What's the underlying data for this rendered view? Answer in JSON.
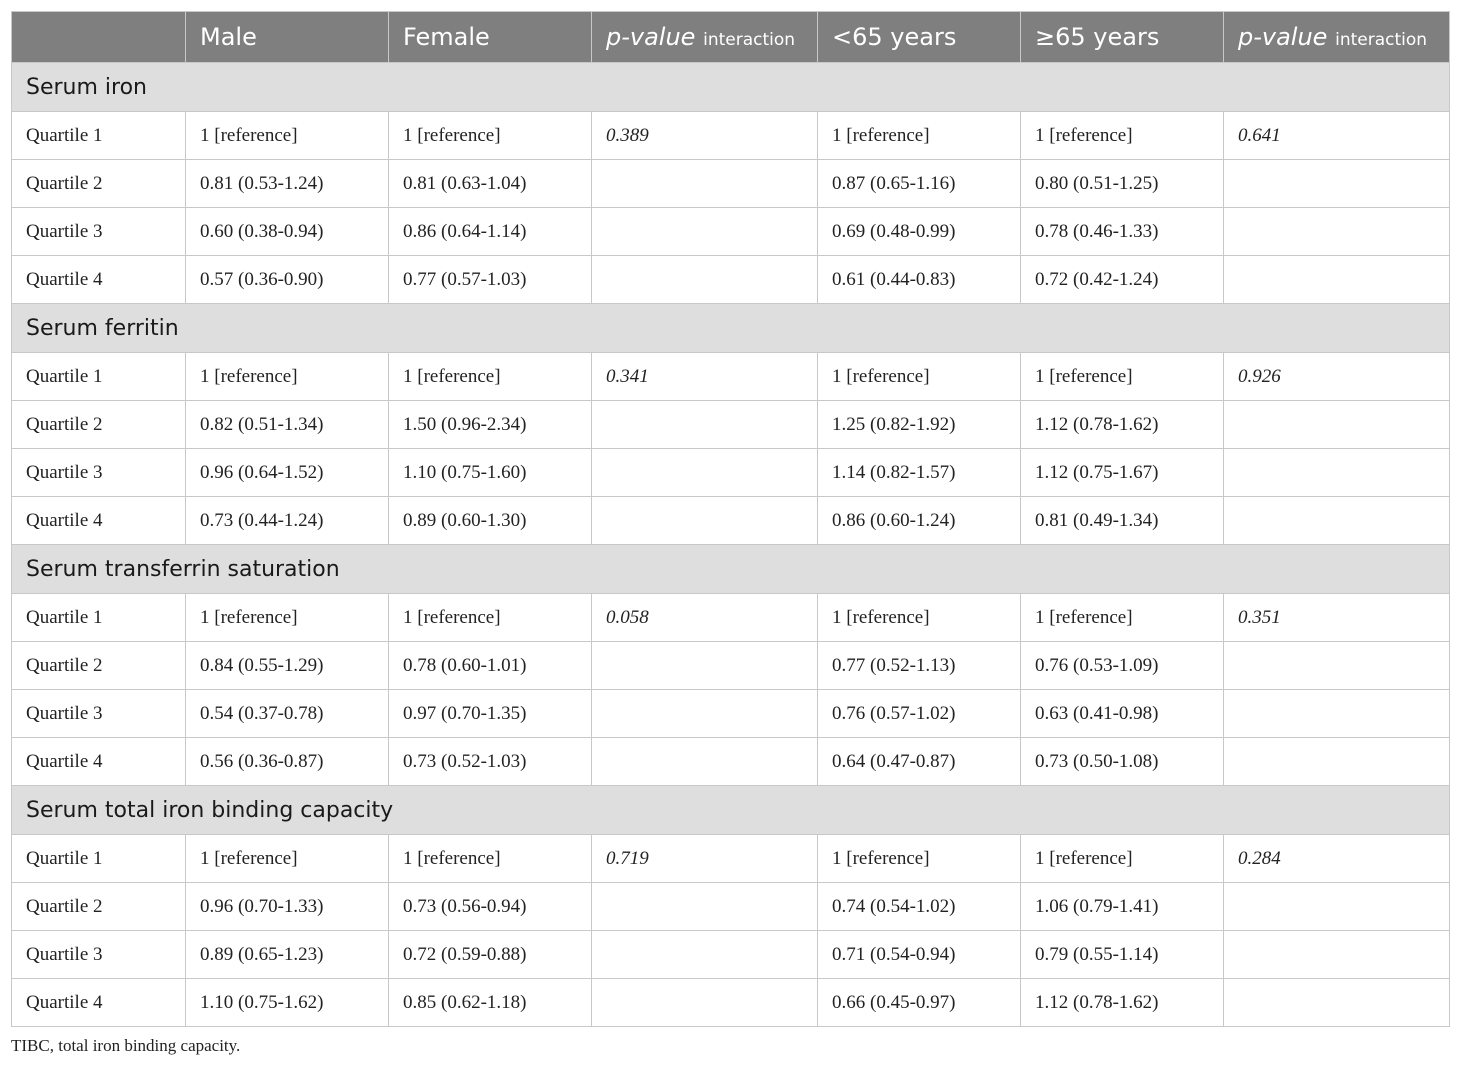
{
  "header": {
    "col0": "",
    "male": "Male",
    "female": "Female",
    "p_label": "p-value",
    "p_sub": "interaction",
    "under65": "<65 years",
    "over65": "≥65 years",
    "p2_label": "p-value",
    "p2_sub": "interaction"
  },
  "sections": [
    {
      "title": "Serum iron",
      "rows": [
        {
          "label": "Quartile 1",
          "male": "1 [reference]",
          "female": "1 [reference]",
          "p1": "0.389",
          "u65": "1 [reference]",
          "o65": "1 [reference]",
          "p2": "0.641"
        },
        {
          "label": "Quartile 2",
          "male": "0.81 (0.53-1.24)",
          "female": "0.81 (0.63-1.04)",
          "p1": "",
          "u65": "0.87 (0.65-1.16)",
          "o65": "0.80 (0.51-1.25)",
          "p2": ""
        },
        {
          "label": "Quartile 3",
          "male": "0.60 (0.38-0.94)",
          "female": "0.86 (0.64-1.14)",
          "p1": "",
          "u65": "0.69 (0.48-0.99)",
          "o65": "0.78 (0.46-1.33)",
          "p2": ""
        },
        {
          "label": "Quartile 4",
          "male": "0.57 (0.36-0.90)",
          "female": "0.77 (0.57-1.03)",
          "p1": "",
          "u65": "0.61 (0.44-0.83)",
          "o65": "0.72 (0.42-1.24)",
          "p2": ""
        }
      ]
    },
    {
      "title": "Serum ferritin",
      "rows": [
        {
          "label": "Quartile 1",
          "male": "1 [reference]",
          "female": "1 [reference]",
          "p1": "0.341",
          "u65": "1 [reference]",
          "o65": "1 [reference]",
          "p2": "0.926"
        },
        {
          "label": "Quartile 2",
          "male": "0.82 (0.51-1.34)",
          "female": "1.50 (0.96-2.34)",
          "p1": "",
          "u65": "1.25 (0.82-1.92)",
          "o65": "1.12 (0.78-1.62)",
          "p2": ""
        },
        {
          "label": "Quartile 3",
          "male": "0.96 (0.64-1.52)",
          "female": "1.10 (0.75-1.60)",
          "p1": "",
          "u65": "1.14 (0.82-1.57)",
          "o65": "1.12 (0.75-1.67)",
          "p2": ""
        },
        {
          "label": "Quartile 4",
          "male": "0.73 (0.44-1.24)",
          "female": "0.89 (0.60-1.30)",
          "p1": "",
          "u65": "0.86 (0.60-1.24)",
          "o65": "0.81 (0.49-1.34)",
          "p2": ""
        }
      ]
    },
    {
      "title": "Serum transferrin saturation",
      "rows": [
        {
          "label": "Quartile 1",
          "male": "1 [reference]",
          "female": "1 [reference]",
          "p1": "0.058",
          "u65": "1 [reference]",
          "o65": "1 [reference]",
          "p2": "0.351"
        },
        {
          "label": "Quartile 2",
          "male": "0.84 (0.55-1.29)",
          "female": "0.78 (0.60-1.01)",
          "p1": "",
          "u65": "0.77 (0.52-1.13)",
          "o65": "0.76 (0.53-1.09)",
          "p2": ""
        },
        {
          "label": "Quartile 3",
          "male": "0.54 (0.37-0.78)",
          "female": "0.97 (0.70-1.35)",
          "p1": "",
          "u65": "0.76 (0.57-1.02)",
          "o65": "0.63 (0.41-0.98)",
          "p2": ""
        },
        {
          "label": "Quartile 4",
          "male": "0.56 (0.36-0.87)",
          "female": "0.73 (0.52-1.03)",
          "p1": "",
          "u65": "0.64 (0.47-0.87)",
          "o65": "0.73 (0.50-1.08)",
          "p2": ""
        }
      ]
    },
    {
      "title": "Serum total iron binding capacity",
      "rows": [
        {
          "label": "Quartile 1",
          "male": "1 [reference]",
          "female": "1 [reference]",
          "p1": "0.719",
          "u65": "1 [reference]",
          "o65": "1 [reference]",
          "p2": "0.284"
        },
        {
          "label": "Quartile 2",
          "male": "0.96 (0.70-1.33)",
          "female": "0.73 (0.56-0.94)",
          "p1": "",
          "u65": "0.74 (0.54-1.02)",
          "o65": "1.06 (0.79-1.41)",
          "p2": ""
        },
        {
          "label": "Quartile 3",
          "male": "0.89 (0.65-1.23)",
          "female": "0.72 (0.59-0.88)",
          "p1": "",
          "u65": "0.71 (0.54-0.94)",
          "o65": "0.79 (0.55-1.14)",
          "p2": ""
        },
        {
          "label": "Quartile 4",
          "male": "1.10 (0.75-1.62)",
          "female": "0.85 (0.62-1.18)",
          "p1": "",
          "u65": "0.66 (0.45-0.97)",
          "o65": "1.12 (0.78-1.62)",
          "p2": ""
        }
      ]
    }
  ],
  "footnote": "TIBC, total iron binding capacity."
}
